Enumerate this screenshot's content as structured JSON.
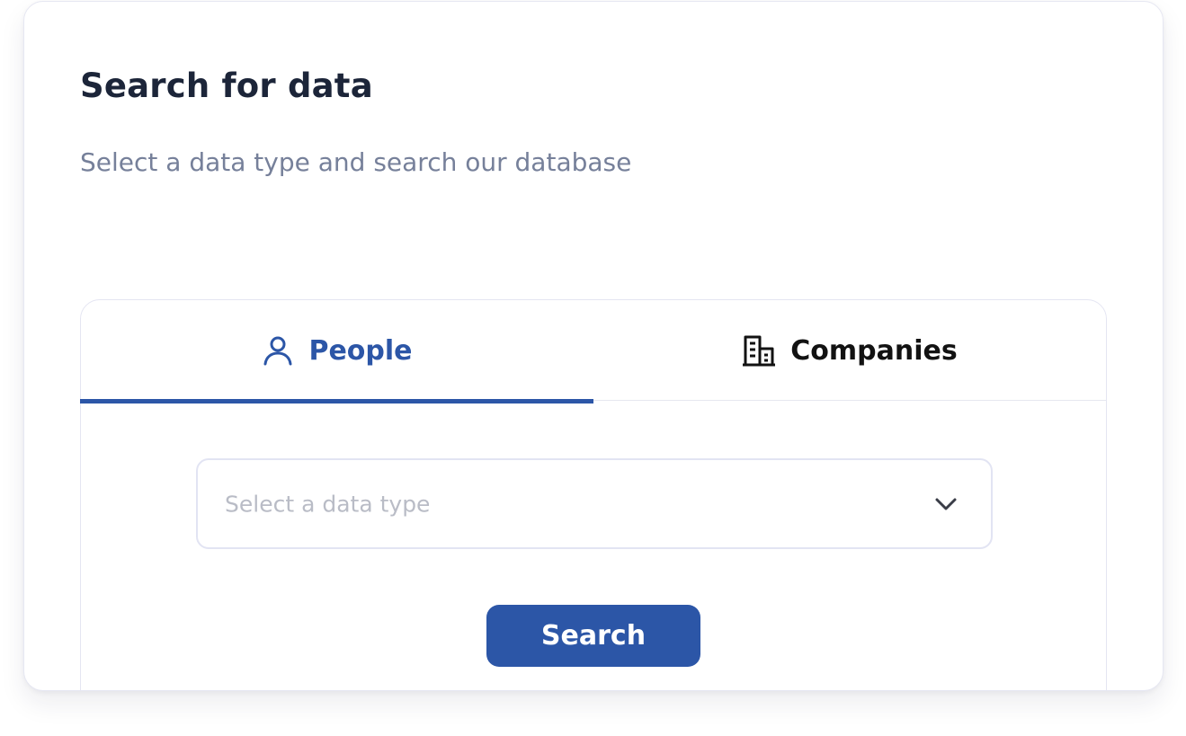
{
  "header": {
    "title": "Search for data",
    "subtitle": "Select a data type and search our database"
  },
  "tabs": [
    {
      "label": "People",
      "icon": "person-icon",
      "active": true
    },
    {
      "label": "Companies",
      "icon": "building-icon",
      "active": false
    }
  ],
  "form": {
    "data_type_select": {
      "placeholder": "Select a data type",
      "value": ""
    },
    "search_button_label": "Search"
  },
  "colors": {
    "accent": "#2c56a7",
    "title_text": "#1c2539",
    "muted_text": "#76809a",
    "placeholder_text": "#b9bcc6",
    "border": "#e2e4f3"
  }
}
